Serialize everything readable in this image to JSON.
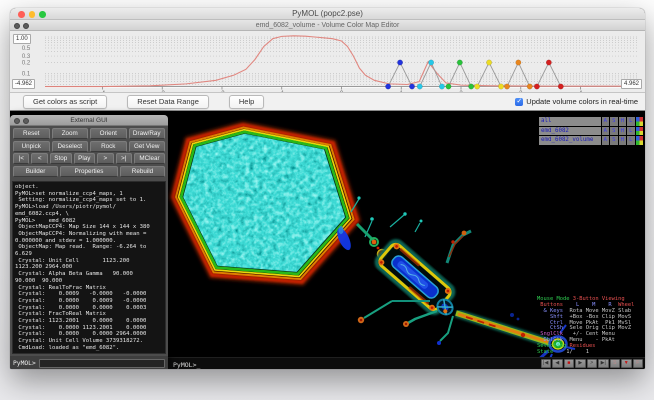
{
  "window": {
    "title": "PyMOL (popc2.pse)"
  },
  "editor": {
    "title": "emd_6082_volume - Volume Color Map Editor",
    "ymax_box": "1.00",
    "xmin_box": "-4.962",
    "xmax_box": "4.962",
    "buttons": {
      "get_colors": "Get colors as script",
      "reset_range": "Reset Data Range",
      "help": "Help"
    },
    "realtime_checkbox": {
      "label": "Update volume colors in real-time",
      "checked": true,
      "check_glyph": "✓",
      "accent": "#2a6ae8"
    }
  },
  "chart_data": {
    "type": "line",
    "title": "volume histogram with color/alpha transfer points",
    "x_range": [
      -4.962,
      4.962
    ],
    "y_scale": "log",
    "y_tick_labels": [
      0.5,
      0.3,
      0.2,
      0.1
    ],
    "x_ticks": [
      -4,
      -3,
      -2,
      -1,
      0,
      1,
      2,
      3,
      4
    ],
    "gridlines": [
      1.0,
      0.9,
      0.8,
      0.7,
      0.6,
      0.5,
      0.4,
      0.3,
      0.2,
      0.1,
      0.09,
      0.08,
      0.07,
      0.06,
      0.05
    ],
    "histogram": {
      "color": "#e0827a",
      "points": [
        [
          -4.962,
          0.044
        ],
        [
          -4.0,
          0.044
        ],
        [
          -3.2,
          0.046
        ],
        [
          -2.6,
          0.052
        ],
        [
          -2.1,
          0.065
        ],
        [
          -1.8,
          0.09
        ],
        [
          -1.6,
          0.13
        ],
        [
          -1.45,
          0.24
        ],
        [
          -1.3,
          0.55
        ],
        [
          -1.15,
          0.9
        ],
        [
          -1.0,
          1.04
        ],
        [
          -0.8,
          1.08
        ],
        [
          -0.6,
          1.05
        ],
        [
          -0.45,
          1.0
        ],
        [
          -0.3,
          0.95
        ],
        [
          -0.15,
          0.9
        ],
        [
          0.0,
          0.78
        ],
        [
          0.1,
          0.55
        ],
        [
          0.2,
          0.3
        ],
        [
          0.3,
          0.14
        ],
        [
          0.4,
          0.09
        ],
        [
          0.55,
          0.065
        ],
        [
          0.8,
          0.052
        ],
        [
          1.1,
          0.05
        ],
        [
          1.3,
          0.06
        ],
        [
          1.45,
          0.21
        ],
        [
          1.6,
          0.1
        ],
        [
          1.75,
          0.055
        ],
        [
          2.0,
          0.048
        ],
        [
          2.5,
          0.046
        ],
        [
          3.5,
          0.045
        ],
        [
          4.962,
          0.045
        ]
      ]
    },
    "color_points": [
      {
        "color": "#2233dd",
        "base1": 0.78,
        "peak": 0.98,
        "base2": 1.18,
        "alpha": 0.2
      },
      {
        "color": "#26c8e8",
        "base1": 1.31,
        "peak": 1.5,
        "base2": 1.68,
        "alpha": 0.2
      },
      {
        "color": "#28c23a",
        "base1": 1.79,
        "peak": 1.98,
        "base2": 2.17,
        "alpha": 0.2
      },
      {
        "color": "#ecdc24",
        "base1": 2.27,
        "peak": 2.47,
        "base2": 2.67,
        "alpha": 0.2
      },
      {
        "color": "#e8861e",
        "base1": 2.77,
        "peak": 2.96,
        "base2": 3.15,
        "alpha": 0.2
      },
      {
        "color": "#d42020",
        "base1": 3.27,
        "peak": 3.47,
        "base2": 3.67,
        "alpha": 0.2
      }
    ]
  },
  "external_gui": {
    "title": "External GUI",
    "button_rows": [
      [
        "Reset",
        "Zoom",
        "Orient",
        "Draw/Ray"
      ],
      [
        "Unpick",
        "Deselect",
        "Rock",
        "Get View"
      ],
      [
        "|<",
        "<",
        "Stop",
        "Play",
        ">",
        ">|",
        "MClear"
      ],
      [
        "Builder",
        "Properties",
        "Rebuild"
      ]
    ],
    "console_lines": [
      "object.",
      "PyMOL>set normalize_ccp4_maps, 1",
      " Setting: normalize_ccp4_maps set to 1.",
      "PyMOL>load /Users/piotr/pymol/",
      "emd_6082.ccp4, \\",
      "PyMOL>    emd_6082",
      " ObjectMapCCP4: Map Size 144 x 144 x 380",
      " ObjectMapCCP4: Normalizing with mean =",
      "0.000000 and stdev = 1.000000.",
      " ObjectMap: Map read.  Range: -6.264 to",
      "6.629",
      " Crystal: Unit Cell       1123.200",
      "1123.200 2964.000",
      " Crystal: Alpha Beta Gamma   90.000",
      "90.000  90.000",
      " Crystal: RealToFrac Matrix",
      " Crystal:    0.0009   -0.0000   -0.0000",
      " Crystal:    0.0000    0.0009   -0.0000",
      " Crystal:    0.0000    0.0000    0.0003",
      " Crystal: FracToReal Matrix",
      " Crystal: 1123.2001    0.0000    0.0000",
      " Crystal:    0.0000 1123.2001    0.0000",
      " Crystal:    0.0000    0.0000 2964.0000",
      " Crystal: Unit Cell Volume 3739318272.",
      " CmdLoad: loaded as \"emd_6082\"."
    ],
    "prompt": "PyMOL>"
  },
  "viewport": {
    "prompt": "PyMOL>_"
  },
  "right_gui": {
    "objects": [
      {
        "name": "all",
        "buttons": [
          "A",
          "S",
          "H",
          "L",
          "C"
        ]
      },
      {
        "name": "emd_6082",
        "buttons": [
          "A",
          "S",
          "H",
          "L",
          "C"
        ]
      },
      {
        "name": "emd_6082_volume",
        "buttons": [
          "A",
          "S",
          "H",
          "L",
          "C"
        ]
      }
    ],
    "mouse_panel": {
      "palette": {
        "green": "#2ecc50",
        "red": "#e85050",
        "blue": "#8890ff",
        "gray": "#c8c8c8",
        "mag": "#cc60cc"
      },
      "lines": [
        [
          {
            "t": "Mouse Mode ",
            "c": "green"
          },
          {
            "t": "3-Button Viewing",
            "c": "red"
          }
        ],
        [
          {
            "t": " Buttons ",
            "c": "red"
          },
          {
            "t": "   L    M    R ",
            "c": "blue"
          },
          {
            "t": " Wheel",
            "c": "red"
          }
        ],
        [
          {
            "t": "  & Keys ",
            "c": "blue"
          },
          {
            "t": " Rota Move MovZ Slab",
            "c": "gray"
          }
        ],
        [
          {
            "t": "    Shft ",
            "c": "blue"
          },
          {
            "t": " +Box -Box Clip MovS",
            "c": "gray"
          }
        ],
        [
          {
            "t": "    Ctrl ",
            "c": "blue"
          },
          {
            "t": " Move PkAt  Pk1 MvSl",
            "c": "gray"
          }
        ],
        [
          {
            "t": "    CtSh ",
            "c": "blue"
          },
          {
            "t": " Sele Orig Clip MovZ",
            "c": "gray"
          }
        ],
        [
          {
            "t": " SnglClk ",
            "c": "mag"
          },
          {
            "t": "  +/- Cent Menu",
            "c": "gray"
          }
        ],
        [
          {
            "t": "  DblClk ",
            "c": "blue"
          },
          {
            "t": " Menu    - PkAt",
            "c": "gray"
          }
        ],
        [
          {
            "t": "Selecting ",
            "c": "green"
          },
          {
            "t": "Residues",
            "c": "red"
          }
        ],
        [
          {
            "t": "State ",
            "c": "green"
          },
          {
            "t": "   1/    1",
            "c": "gray"
          }
        ]
      ]
    },
    "vcr_buttons": [
      {
        "g": "|◀"
      },
      {
        "g": "◀"
      },
      {
        "g": "■",
        "style": "red"
      },
      {
        "g": "▶"
      },
      {
        "g": ">"
      },
      {
        "g": "▶|"
      },
      {
        "g": "S",
        "style": "dim"
      },
      {
        "g": "▼",
        "style": "red"
      },
      {
        "g": "F",
        "style": "dim"
      }
    ]
  }
}
